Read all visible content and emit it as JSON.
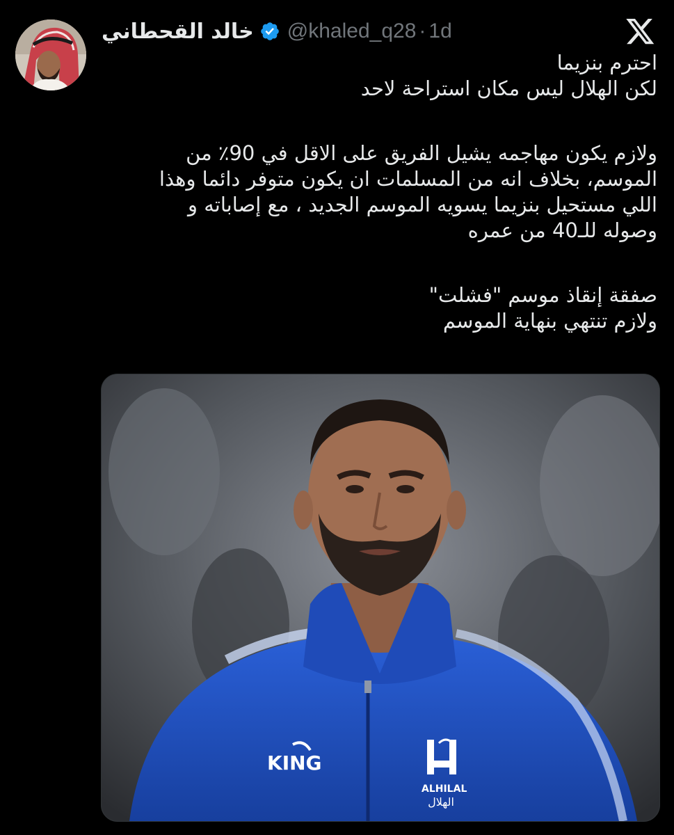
{
  "author": {
    "display_name": "خالد القحطاني",
    "handle": "@khaled_q28",
    "separator": "·",
    "age": "1d",
    "verified": true,
    "avatar_icon": "profile-avatar"
  },
  "brand": {
    "logo_icon": "x-logo-icon"
  },
  "tweet": {
    "lines": [
      "احترم بنزيما",
      "لكن الهلال ليس مكان استراحة لاحد",
      "ولازم يكون مهاجمه يشيل الفريق على الاقل في 90٪ من",
      "الموسم، بخلاف انه من المسلمات ان يكون متوفر دائما وهذا",
      "اللي مستحيل بنزيما يسويه الموسم الجديد ، مع إصاباته و",
      "وصوله للـ40 من عمره",
      "صفقة إنقاذ موسم \"فشلت\"",
      "ولازم تنتهي بنهاية الموسم"
    ]
  },
  "media": {
    "jacket_brand": "KING",
    "club_name_en": "ALHILAL",
    "club_name_ar": "الهلال",
    "jacket_color": "#1d4fc4"
  },
  "colors": {
    "background": "#000000",
    "text": "#e7e9ea",
    "muted": "#71767b",
    "verified": "#1d9bf0"
  }
}
